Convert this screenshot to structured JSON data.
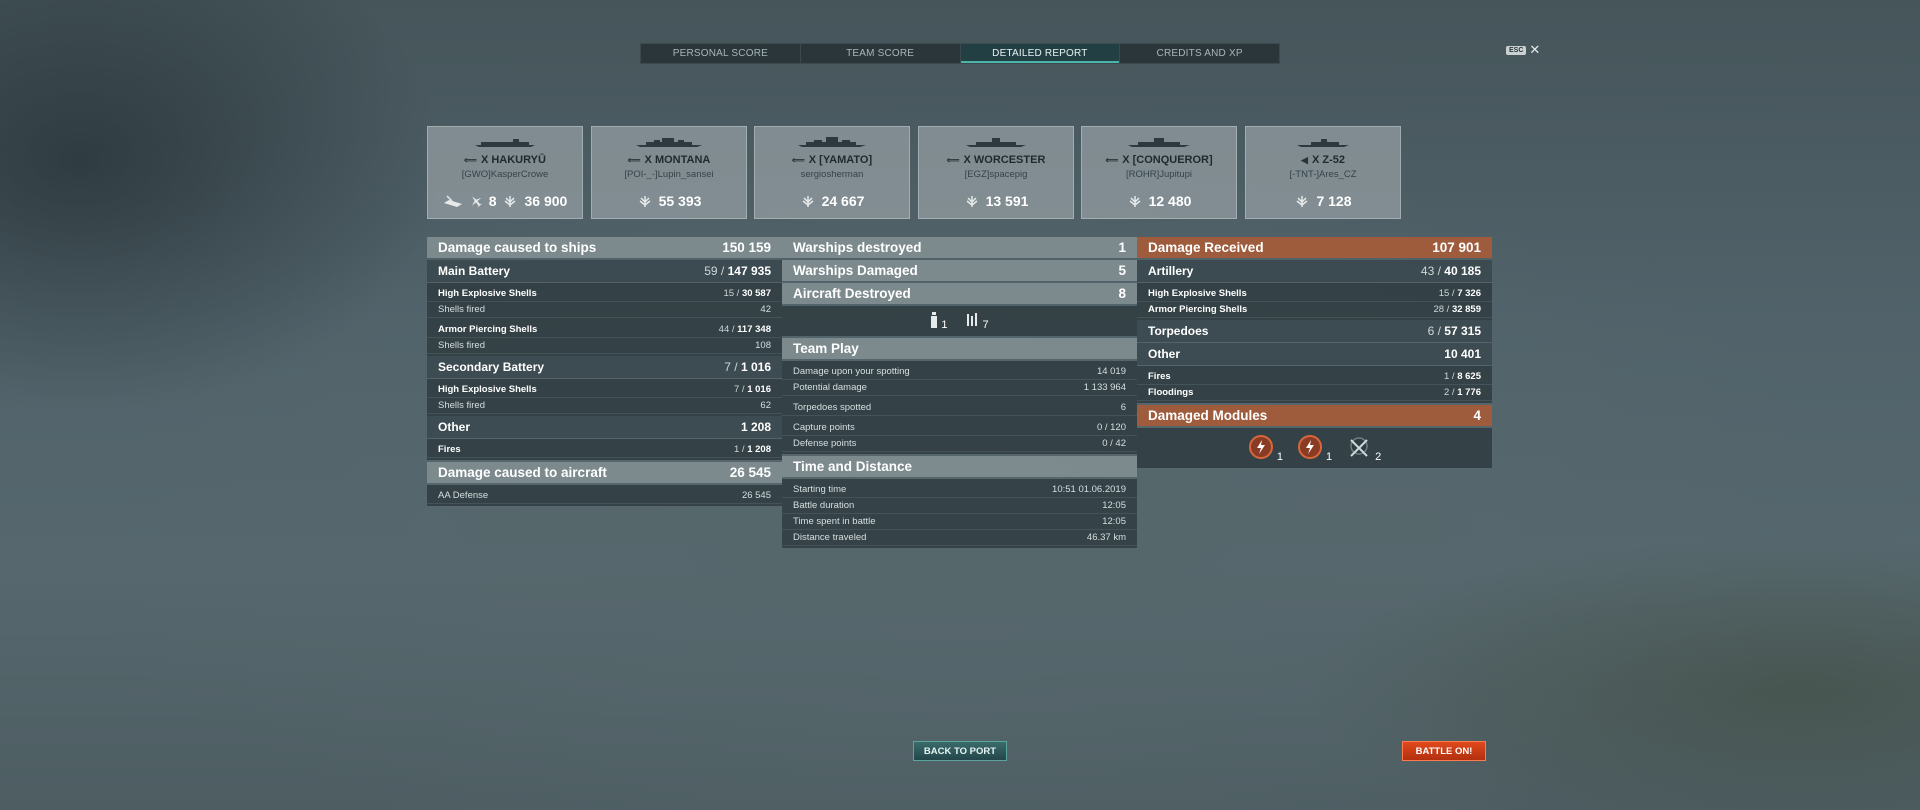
{
  "tabs": [
    {
      "label": "PERSONAL SCORE"
    },
    {
      "label": "TEAM SCORE"
    },
    {
      "label": "DETAILED REPORT"
    },
    {
      "label": "CREDITS AND XP"
    }
  ],
  "esc": {
    "key": "ESC",
    "close": "✕"
  },
  "ships": [
    {
      "tier_name": "X HAKURYŪ",
      "player": "[GWO]KasperCrowe",
      "planes": "8",
      "score": "36 900"
    },
    {
      "tier_name": "X MONTANA",
      "player": "[POI-_-]Lupin_sansei",
      "score": "55 393"
    },
    {
      "tier_name": "X [YAMATO]",
      "player": "sergiosherman",
      "score": "24 667"
    },
    {
      "tier_name": "X WORCESTER",
      "player": "[EGZ]spacepig",
      "score": "13 591"
    },
    {
      "tier_name": "X [CONQUEROR]",
      "player": "[ROHR]Jupitupi",
      "score": "12 480"
    },
    {
      "tier_name": "X Z-52",
      "player": "[-TNT-]Ares_CZ",
      "score": "7 128"
    }
  ],
  "left": {
    "damage_ships": {
      "label": "Damage caused to ships",
      "value": "150 159"
    },
    "main_battery": {
      "label": "Main Battery",
      "hits": "59",
      "value": "147 935"
    },
    "mb_he": {
      "label": "High Explosive Shells",
      "hits": "15",
      "value": "30 587"
    },
    "mb_he_fired": {
      "label": "Shells fired",
      "value": "42"
    },
    "mb_ap": {
      "label": "Armor Piercing Shells",
      "hits": "44",
      "value": "117 348"
    },
    "mb_ap_fired": {
      "label": "Shells fired",
      "value": "108"
    },
    "secondary": {
      "label": "Secondary Battery",
      "hits": "7",
      "value": "1 016"
    },
    "sec_he": {
      "label": "High Explosive Shells",
      "hits": "7",
      "value": "1 016"
    },
    "sec_fired": {
      "label": "Shells fired",
      "value": "62"
    },
    "other": {
      "label": "Other",
      "value": "1 208"
    },
    "fires": {
      "label": "Fires",
      "hits": "1",
      "value": "1 208"
    },
    "damage_aircraft": {
      "label": "Damage caused to aircraft",
      "value": "26 545"
    },
    "aa": {
      "label": "AA Defense",
      "value": "26 545"
    }
  },
  "middle": {
    "destroyed": {
      "label": "Warships destroyed",
      "value": "1"
    },
    "damaged": {
      "label": "Warships Damaged",
      "value": "5"
    },
    "aircraft": {
      "label": "Aircraft Destroyed",
      "value": "8"
    },
    "kill_icons": {
      "ship_count": "1",
      "plane_count": "7"
    },
    "team_play": {
      "label": "Team Play"
    },
    "spotting": {
      "label": "Damage upon your spotting",
      "value": "14 019"
    },
    "potential": {
      "label": "Potential damage",
      "value": "1 133 964"
    },
    "torp_spotted": {
      "label": "Torpedoes spotted",
      "value": "6"
    },
    "capture": {
      "label": "Capture points",
      "value": "0 / 120"
    },
    "defense": {
      "label": "Defense points",
      "value": "0 / 42"
    },
    "time_distance": {
      "label": "Time and Distance"
    },
    "start": {
      "label": "Starting time",
      "value": "10:51  01.06.2019"
    },
    "duration": {
      "label": "Battle duration",
      "value": "12:05"
    },
    "spent": {
      "label": "Time spent in battle",
      "value": "12:05"
    },
    "distance": {
      "label": "Distance traveled",
      "value": "46.37 km"
    }
  },
  "right": {
    "received": {
      "label": "Damage Received",
      "value": "107 901"
    },
    "artillery": {
      "label": "Artillery",
      "hits": "43",
      "value": "40 185"
    },
    "art_he": {
      "label": "High Explosive Shells",
      "hits": "15",
      "value": "7 326"
    },
    "art_ap": {
      "label": "Armor Piercing Shells",
      "hits": "28",
      "value": "32 859"
    },
    "torpedoes": {
      "label": "Torpedoes",
      "hits": "6",
      "value": "57 315"
    },
    "other": {
      "label": "Other",
      "value": "10 401"
    },
    "fires": {
      "label": "Fires",
      "hits": "1",
      "value": "8 625"
    },
    "floodings": {
      "label": "Floodings",
      "hits": "2",
      "value": "1 776"
    },
    "modules": {
      "label": "Damaged Modules",
      "value": "4"
    },
    "module_counts": {
      "m1": "1",
      "m2": "1",
      "m3": "2"
    }
  },
  "buttons": {
    "back": "BACK TO PORT",
    "battle": "BATTLE ON!"
  },
  "colors": {
    "orange_header": "#a25c3a",
    "accent_teal": "#4bb3a8",
    "battle_button": "#d23c16"
  }
}
